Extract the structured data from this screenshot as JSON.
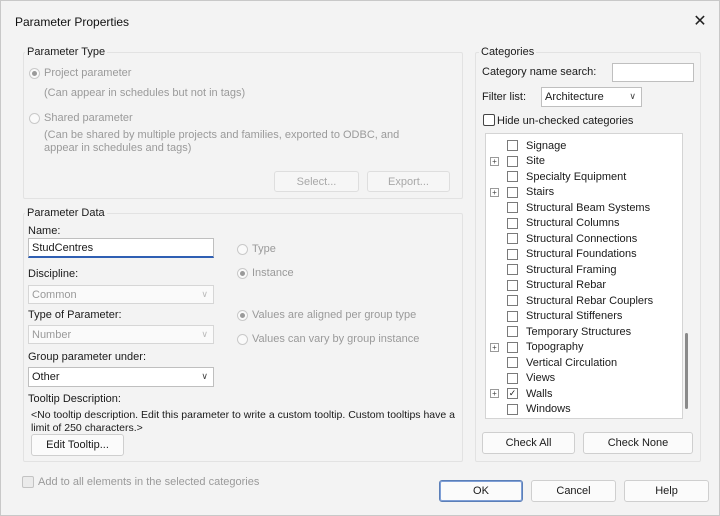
{
  "window": {
    "title": "Parameter Properties",
    "close_glyph": "✕"
  },
  "parameter_type": {
    "label": "Parameter Type",
    "project_label": "Project parameter",
    "project_desc": "(Can appear in schedules but not in tags)",
    "shared_label": "Shared parameter",
    "shared_desc_1": "(Can be shared by multiple projects and families, exported to ODBC, and",
    "shared_desc_2": "appear in schedules and tags)",
    "select_button": "Select...",
    "export_button": "Export..."
  },
  "parameter_data": {
    "label": "Parameter Data",
    "name_label": "Name:",
    "name_value": "StudCentres",
    "type_label": "Type",
    "instance_label": "Instance",
    "discipline_label": "Discipline:",
    "discipline_value": "Common",
    "type_of_param_label": "Type of Parameter:",
    "type_of_param_value": "Number",
    "aligned_label": "Values are aligned per group type",
    "vary_label": "Values can vary by group instance",
    "group_label": "Group parameter under:",
    "group_value": "Other",
    "tooltip_label": "Tooltip Description:",
    "tooltip_text_1": "<No tooltip description. Edit this parameter to write a custom tooltip. Custom tooltips have a",
    "tooltip_text_2": "limit of 250 characters.>",
    "edit_tooltip_button": "Edit Tooltip..."
  },
  "add_all": {
    "label": "Add to all elements in the selected categories"
  },
  "categories": {
    "label": "Categories",
    "search_label": "Category name search:",
    "search_value": "",
    "filter_label": "Filter list:",
    "filter_value": "Architecture",
    "hide_label": "Hide un-checked categories",
    "items": [
      {
        "label": "Signage",
        "expandable": false,
        "checked": false
      },
      {
        "label": "Site",
        "expandable": true,
        "checked": false
      },
      {
        "label": "Specialty Equipment",
        "expandable": false,
        "checked": false
      },
      {
        "label": "Stairs",
        "expandable": true,
        "checked": false
      },
      {
        "label": "Structural Beam Systems",
        "expandable": false,
        "checked": false
      },
      {
        "label": "Structural Columns",
        "expandable": false,
        "checked": false
      },
      {
        "label": "Structural Connections",
        "expandable": false,
        "checked": false
      },
      {
        "label": "Structural Foundations",
        "expandable": false,
        "checked": false
      },
      {
        "label": "Structural Framing",
        "expandable": false,
        "checked": false
      },
      {
        "label": "Structural Rebar",
        "expandable": false,
        "checked": false
      },
      {
        "label": "Structural Rebar Couplers",
        "expandable": false,
        "checked": false
      },
      {
        "label": "Structural Stiffeners",
        "expandable": false,
        "checked": false
      },
      {
        "label": "Temporary Structures",
        "expandable": false,
        "checked": false
      },
      {
        "label": "Topography",
        "expandable": true,
        "checked": false
      },
      {
        "label": "Vertical Circulation",
        "expandable": false,
        "checked": false
      },
      {
        "label": "Views",
        "expandable": false,
        "checked": false
      },
      {
        "label": "Walls",
        "expandable": true,
        "checked": true
      },
      {
        "label": "Windows",
        "expandable": false,
        "checked": false
      }
    ],
    "check_all_button": "Check All",
    "check_none_button": "Check None"
  },
  "footer": {
    "ok_button": "OK",
    "cancel_button": "Cancel",
    "help_button": "Help"
  }
}
